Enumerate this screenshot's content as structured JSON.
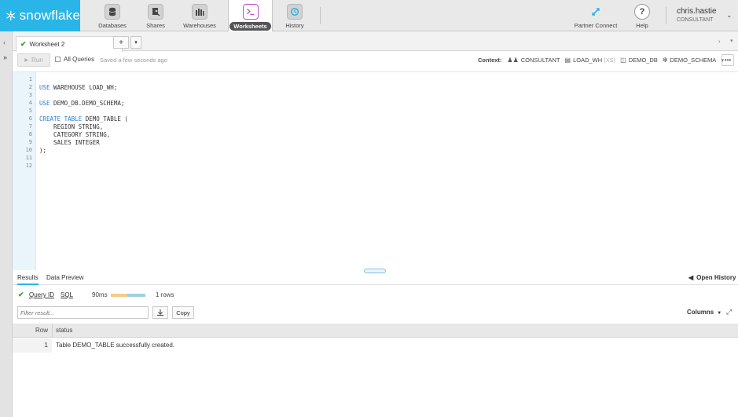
{
  "brand": {
    "name": "snowflake",
    "color": "#29b5e8"
  },
  "nav": {
    "tabs": [
      {
        "label": "Databases",
        "icon": "database-icon"
      },
      {
        "label": "Shares",
        "icon": "share-icon"
      },
      {
        "label": "Warehouses",
        "icon": "warehouse-icon"
      },
      {
        "label": "Worksheets",
        "icon": "terminal-icon",
        "active": true
      },
      {
        "label": "History",
        "icon": "history-icon"
      }
    ],
    "right": [
      {
        "label": "Partner Connect",
        "icon": "partner-connect-icon"
      },
      {
        "label": "Help",
        "icon": "help-icon"
      }
    ]
  },
  "user": {
    "name": "chris.hastie",
    "role": "CONSULTANT"
  },
  "worksheet": {
    "tab_label": "Worksheet 2",
    "add_label": "+",
    "dropdown_label": "▾"
  },
  "toolbar": {
    "run_label": "Run",
    "all_queries_label": "All Queries",
    "saved_text": "Saved a few seconds ago",
    "context_label": "Context:",
    "role": "CONSULTANT",
    "warehouse": "LOAD_WH",
    "warehouse_size": "(XS)",
    "database": "DEMO_DB",
    "schema": "DEMO_SCHEMA",
    "more_label": "•••"
  },
  "editor": {
    "lines": [
      {
        "n": "1",
        "kw": "",
        "text": ""
      },
      {
        "n": "2",
        "kw": "USE",
        "text": " WAREHOUSE LOAD_WH;"
      },
      {
        "n": "3",
        "kw": "",
        "text": ""
      },
      {
        "n": "4",
        "kw": "USE",
        "text": " DEMO_DB.DEMO_SCHEMA;"
      },
      {
        "n": "5",
        "kw": "",
        "text": ""
      },
      {
        "n": "6",
        "kw": "CREATE TABLE",
        "text": " DEMO_TABLE ("
      },
      {
        "n": "7",
        "kw": "",
        "text": "    REGION STRING,"
      },
      {
        "n": "8",
        "kw": "",
        "text": "    CATEGORY STRING,"
      },
      {
        "n": "9",
        "kw": "",
        "text": "    SALES INTEGER"
      },
      {
        "n": "10",
        "kw": "",
        "text": ");"
      },
      {
        "n": "11",
        "kw": "",
        "text": ""
      },
      {
        "n": "12",
        "kw": "",
        "text": ""
      }
    ]
  },
  "results": {
    "tabs": [
      "Results",
      "Data Preview"
    ],
    "open_history": "Open History",
    "query_id_label": "Query ID",
    "sql_label": "SQL",
    "duration": "90ms",
    "rows_text": "1 rows",
    "filter_placeholder": "Filter result...",
    "copy_label": "Copy",
    "columns_label": "Columns",
    "headers": {
      "row": "Row",
      "status": "status"
    },
    "rows": [
      {
        "row": "1",
        "status": "Table DEMO_TABLE successfully created."
      }
    ]
  }
}
